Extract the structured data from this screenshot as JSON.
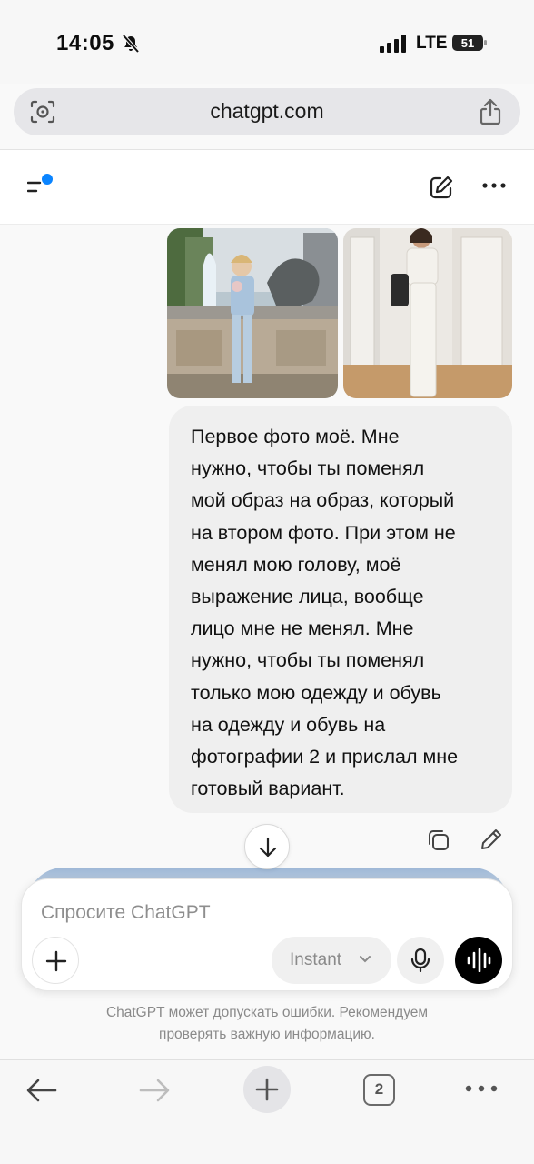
{
  "status_bar": {
    "time": "14:05",
    "network": "LTE",
    "battery": "51"
  },
  "browser": {
    "url": "chatgpt.com",
    "tab_count": "2"
  },
  "chat": {
    "user_message": "Первое фото моё. Мне\nнужно, чтобы ты поменял\nмой образ на образ, который\nна втором фото. При этом не\nменял мою голову, моё\nвыражение лица, вообще\nлицо мне не менял. Мне\nнужно, чтобы ты поменял\nтолько мою одежду и обувь\nна одежду и обувь на\nфотографии 2 и прислал мне\nготовый вариант."
  },
  "composer": {
    "placeholder": "Спросите ChatGPT",
    "mode": "Instant"
  },
  "disclaimer": "ChatGPT может допускать ошибки. Рекомендуем\nпроверять важную информацию.",
  "icons": [
    "camera-lens-icon",
    "share-icon",
    "menu-icon",
    "new-chat-icon",
    "more-icon",
    "copy-icon",
    "edit-icon",
    "arrow-down-icon",
    "plus-icon",
    "chevron-down-icon",
    "mic-icon",
    "voice-waveform-icon",
    "back-icon",
    "forward-icon",
    "new-tab-icon",
    "tabs-icon",
    "more-menu-icon"
  ],
  "colors": {
    "accent_dot": "#0a84ff",
    "voice_button": "#000000",
    "bubble_bg": "#efefef"
  }
}
